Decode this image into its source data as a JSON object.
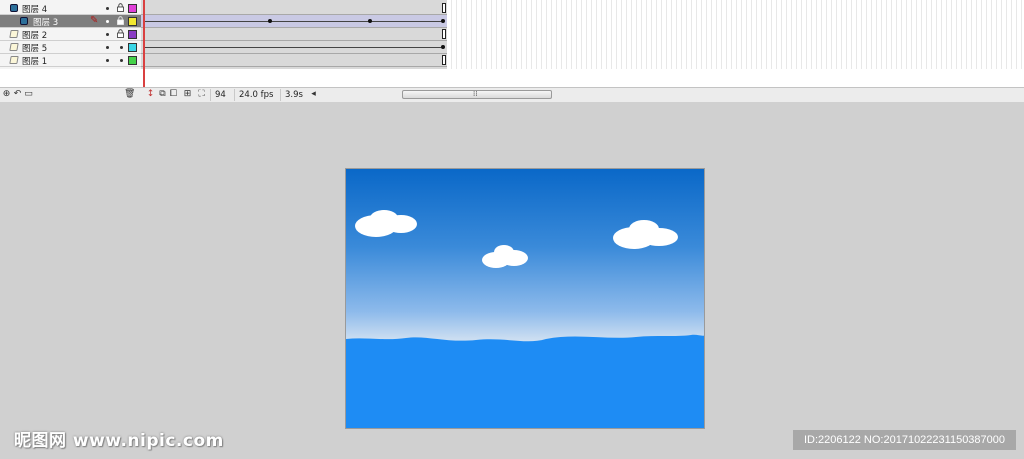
{
  "timeline": {
    "layers": [
      {
        "name": "图层 4",
        "icon": "mask-layer-icon",
        "color": "#e040d8",
        "locked": true,
        "selected": false
      },
      {
        "name": "图层 3",
        "icon": "masked-layer-icon",
        "color": "#f2e830",
        "locked": true,
        "selected": true
      },
      {
        "name": "图层 2",
        "icon": "layer-icon",
        "color": "#8a3cc4",
        "locked": true,
        "selected": false
      },
      {
        "name": "图层 5",
        "icon": "layer-icon",
        "color": "#3ad6e6",
        "locked": false,
        "selected": false
      },
      {
        "name": "图层 1",
        "icon": "layer-icon",
        "color": "#45d24a",
        "locked": false,
        "selected": false
      }
    ],
    "footer": {
      "current_frame": "94",
      "frame_rate": "24.0 fps",
      "elapsed_time": "3.9s"
    }
  },
  "stage": {
    "sky_top_color": "#0a68c8",
    "water_color": "#1e8cf4"
  },
  "watermark": {
    "left_text": "昵图网 www.nipic.com",
    "right_text": "ID:2206122 NO:20171022231150387000"
  }
}
